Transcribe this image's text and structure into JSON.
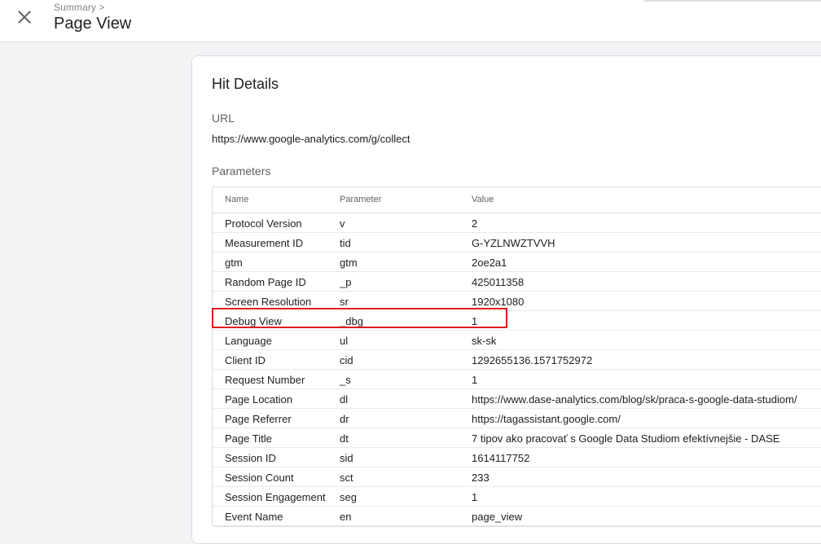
{
  "header": {
    "breadcrumb": "Summary >",
    "title": "Page View"
  },
  "card": {
    "title": "Hit Details",
    "url_label": "URL",
    "url_value": "https://www.google-analytics.com/g/collect",
    "params_label": "Parameters"
  },
  "table": {
    "headers": {
      "name": "Name",
      "parameter": "Parameter",
      "value": "Value"
    },
    "rows": [
      {
        "name": "Protocol Version",
        "parameter": "v",
        "value": "2"
      },
      {
        "name": "Measurement ID",
        "parameter": "tid",
        "value": "G-YZLNWZTVVH"
      },
      {
        "name": "gtm",
        "parameter": "gtm",
        "value": "2oe2a1"
      },
      {
        "name": "Random Page ID",
        "parameter": "_p",
        "value": "425011358"
      },
      {
        "name": "Screen Resolution",
        "parameter": "sr",
        "value": "1920x1080"
      },
      {
        "name": "Debug View",
        "parameter": "_dbg",
        "value": "1"
      },
      {
        "name": "Language",
        "parameter": "ul",
        "value": "sk-sk"
      },
      {
        "name": "Client ID",
        "parameter": "cid",
        "value": "1292655136.1571752972"
      },
      {
        "name": "Request Number",
        "parameter": "_s",
        "value": "1"
      },
      {
        "name": "Page Location",
        "parameter": "dl",
        "value": "https://www.dase-analytics.com/blog/sk/praca-s-google-data-studiom/"
      },
      {
        "name": "Page Referrer",
        "parameter": "dr",
        "value": "https://tagassistant.google.com/"
      },
      {
        "name": "Page Title",
        "parameter": "dt",
        "value": "7 tipov ako pracovať s Google Data Studiom efektívnejšie - DASE"
      },
      {
        "name": "Session ID",
        "parameter": "sid",
        "value": "1614117752"
      },
      {
        "name": "Session Count",
        "parameter": "sct",
        "value": "233"
      },
      {
        "name": "Session Engagement",
        "parameter": "seg",
        "value": "1"
      },
      {
        "name": "Event Name",
        "parameter": "en",
        "value": "page_view"
      }
    ]
  },
  "icons": {
    "close": "close-icon"
  },
  "colors": {
    "highlight": "#e0191f",
    "background": "#f1f3f4"
  }
}
